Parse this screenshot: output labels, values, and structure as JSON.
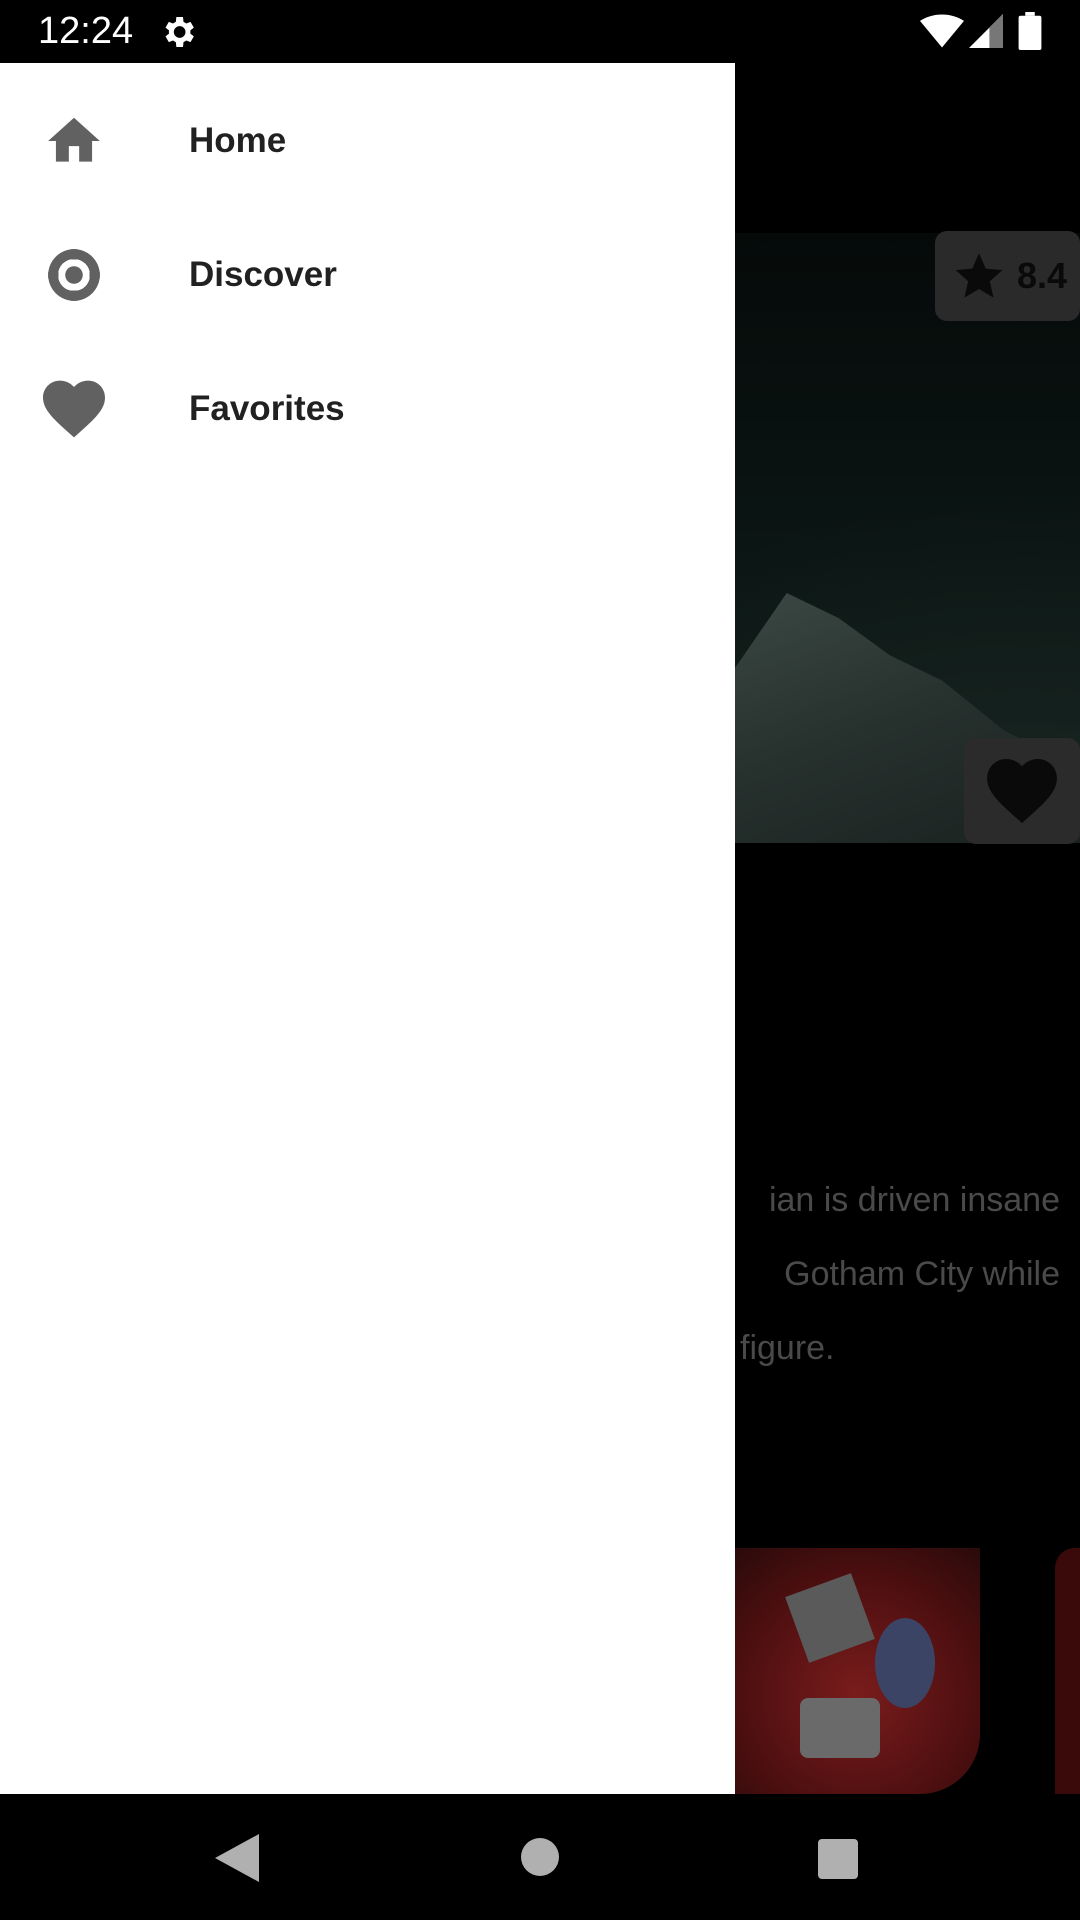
{
  "status_bar": {
    "time": "12:24",
    "icons": [
      "gear-icon",
      "wifi-icon",
      "signal-icon",
      "battery-icon"
    ]
  },
  "drawer": {
    "items": [
      {
        "label": "Home",
        "icon": "home-icon"
      },
      {
        "label": "Discover",
        "icon": "discover-icon"
      },
      {
        "label": "Favorites",
        "icon": "heart-icon"
      }
    ],
    "icon_color": "#616161",
    "text_color": "#212121"
  },
  "background": {
    "rating": "8.4",
    "overview_lines": [
      "ian is driven insane",
      "Gotham City while",
      "figure."
    ]
  },
  "nav_bar": {
    "buttons": [
      "back",
      "home",
      "recents"
    ]
  }
}
